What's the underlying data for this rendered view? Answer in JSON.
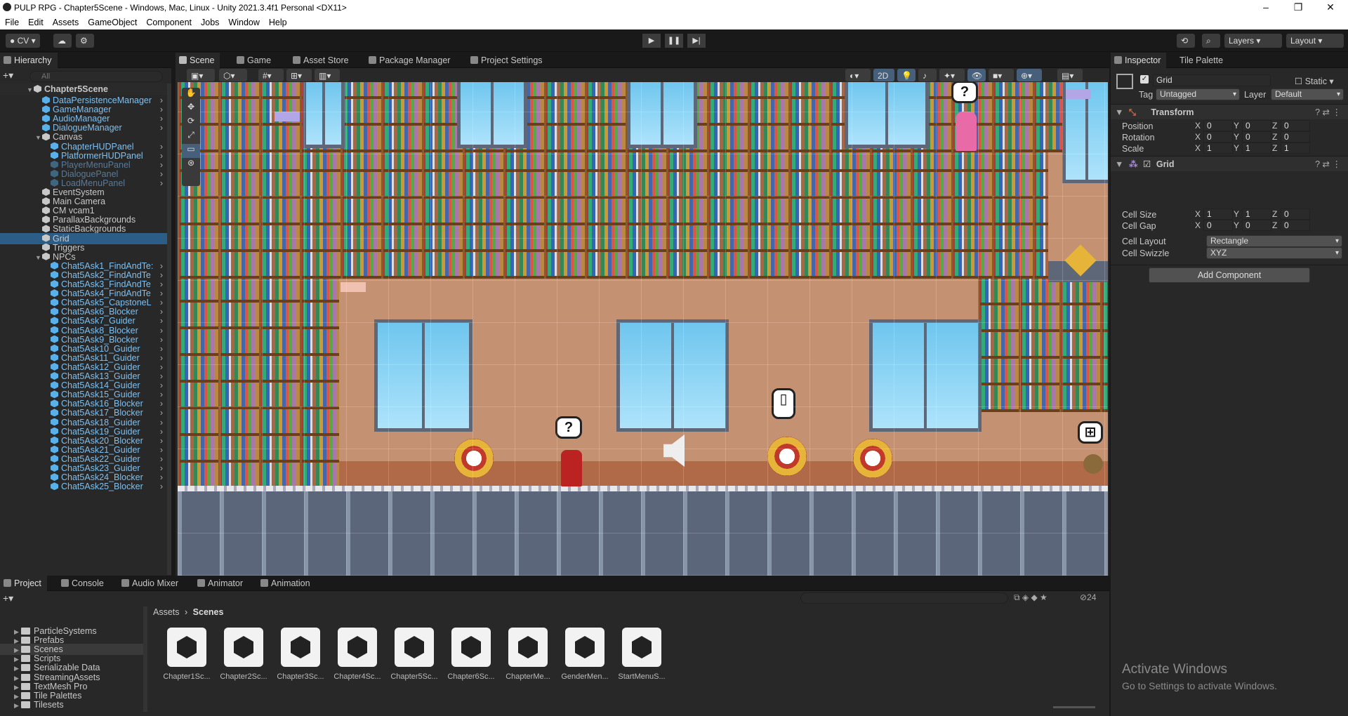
{
  "window": {
    "title": "PULP RPG - Chapter5Scene - Windows, Mac, Linux - Unity 2021.3.4f1 Personal <DX11>"
  },
  "menu": [
    "File",
    "Edit",
    "Assets",
    "GameObject",
    "Component",
    "Jobs",
    "Window",
    "Help"
  ],
  "toolbar": {
    "account": "CV",
    "layers": "Layers",
    "layout": "Layout"
  },
  "hierarchy": {
    "tab": "Hierarchy",
    "search_placeholder": "All",
    "scene": "Chapter5Scene",
    "items": [
      {
        "label": "DataPersistenceManager",
        "type": "prefab"
      },
      {
        "label": "GameManager",
        "type": "prefab"
      },
      {
        "label": "AudioManager",
        "type": "prefab"
      },
      {
        "label": "DialogueManager",
        "type": "prefab"
      },
      {
        "label": "Canvas",
        "type": "normal"
      },
      {
        "label": "ChapterHUDPanel",
        "type": "prefab"
      },
      {
        "label": "PlatformerHUDPanel",
        "type": "prefab"
      },
      {
        "label": "PlayerMenuPanel",
        "type": "dim"
      },
      {
        "label": "DialoguePanel",
        "type": "dim"
      },
      {
        "label": "LoadMenuPanel",
        "type": "dim"
      },
      {
        "label": "EventSystem",
        "type": "normal"
      },
      {
        "label": "Main Camera",
        "type": "normal"
      },
      {
        "label": "CM vcam1",
        "type": "normal"
      },
      {
        "label": "ParallaxBackgrounds",
        "type": "normal"
      },
      {
        "label": "StaticBackgrounds",
        "type": "normal"
      },
      {
        "label": "Grid",
        "type": "selected"
      },
      {
        "label": "Triggers",
        "type": "normal"
      },
      {
        "label": "NPCs",
        "type": "normal"
      },
      {
        "label": "Chat5Ask1_FindAndTe:",
        "type": "prefab"
      },
      {
        "label": "Chat5Ask2_FindAndTe",
        "type": "prefab"
      },
      {
        "label": "Chat5Ask3_FindAndTe",
        "type": "prefab"
      },
      {
        "label": "Chat5Ask4_FindAndTe",
        "type": "prefab"
      },
      {
        "label": "Chat5Ask5_CapstoneL",
        "type": "prefab"
      },
      {
        "label": "Chat5Ask6_Blocker",
        "type": "prefab"
      },
      {
        "label": "Chat5Ask7_Guider",
        "type": "prefab"
      },
      {
        "label": "Chat5Ask8_Blocker",
        "type": "prefab"
      },
      {
        "label": "Chat5Ask9_Blocker",
        "type": "prefab"
      },
      {
        "label": "Chat5Ask10_Guider",
        "type": "prefab"
      },
      {
        "label": "Chat5Ask11_Guider",
        "type": "prefab"
      },
      {
        "label": "Chat5Ask12_Guider",
        "type": "prefab"
      },
      {
        "label": "Chat5Ask13_Guider",
        "type": "prefab"
      },
      {
        "label": "Chat5Ask14_Guider",
        "type": "prefab"
      },
      {
        "label": "Chat5Ask15_Guider",
        "type": "prefab"
      },
      {
        "label": "Chat5Ask16_Blocker",
        "type": "prefab"
      },
      {
        "label": "Chat5Ask17_Blocker",
        "type": "prefab"
      },
      {
        "label": "Chat5Ask18_Guider",
        "type": "prefab"
      },
      {
        "label": "Chat5Ask19_Guider",
        "type": "prefab"
      },
      {
        "label": "Chat5Ask20_Blocker",
        "type": "prefab"
      },
      {
        "label": "Chat5Ask21_Guider",
        "type": "prefab"
      },
      {
        "label": "Chat5Ask22_Guider",
        "type": "prefab"
      },
      {
        "label": "Chat5Ask23_Guider",
        "type": "prefab"
      },
      {
        "label": "Chat5Ask24_Blocker",
        "type": "prefab"
      },
      {
        "label": "Chat5Ask25_Blocker",
        "type": "prefab"
      }
    ]
  },
  "center_tabs": [
    "Scene",
    "Game",
    "Asset Store",
    "Package Manager",
    "Project Settings"
  ],
  "scene_toolbar": {
    "mode_2d": "2D"
  },
  "inspector": {
    "tabs": [
      "Inspector",
      "Tile Palette"
    ],
    "object_name": "Grid",
    "static_label": "Static",
    "tag_label": "Tag",
    "tag_value": "Untagged",
    "layer_label": "Layer",
    "layer_value": "Default",
    "transform": {
      "title": "Transform",
      "position": {
        "label": "Position",
        "x": "0",
        "y": "0",
        "z": "0"
      },
      "rotation": {
        "label": "Rotation",
        "x": "0",
        "y": "0",
        "z": "0"
      },
      "scale": {
        "label": "Scale",
        "x": "1",
        "y": "1",
        "z": "1"
      }
    },
    "grid": {
      "title": "Grid",
      "cell_size": {
        "label": "Cell Size",
        "x": "1",
        "y": "1",
        "z": "0"
      },
      "cell_gap": {
        "label": "Cell Gap",
        "x": "0",
        "y": "0",
        "z": "0"
      },
      "cell_layout": {
        "label": "Cell Layout",
        "value": "Rectangle"
      },
      "cell_swizzle": {
        "label": "Cell Swizzle",
        "value": "XYZ"
      }
    },
    "add_component": "Add Component"
  },
  "bottom_tabs": [
    "Project",
    "Console",
    "Audio Mixer",
    "Animator",
    "Animation"
  ],
  "project": {
    "folders": [
      "ParticleSystems",
      "Prefabs",
      "Scenes",
      "Scripts",
      "Serializable Data",
      "StreamingAssets",
      "TextMesh Pro",
      "Tile Palettes",
      "Tilesets"
    ],
    "selected_folder": "Scenes",
    "breadcrumb": [
      "Assets",
      "Scenes"
    ],
    "badge_count": "24",
    "assets": [
      "Chapter1Sc...",
      "Chapter2Sc...",
      "Chapter3Sc...",
      "Chapter4Sc...",
      "Chapter5Sc...",
      "Chapter6Sc...",
      "ChapterMe...",
      "GenderMen...",
      "StartMenuS..."
    ]
  },
  "activation": {
    "title": "Activate Windows",
    "subtitle": "Go to Settings to activate Windows."
  }
}
